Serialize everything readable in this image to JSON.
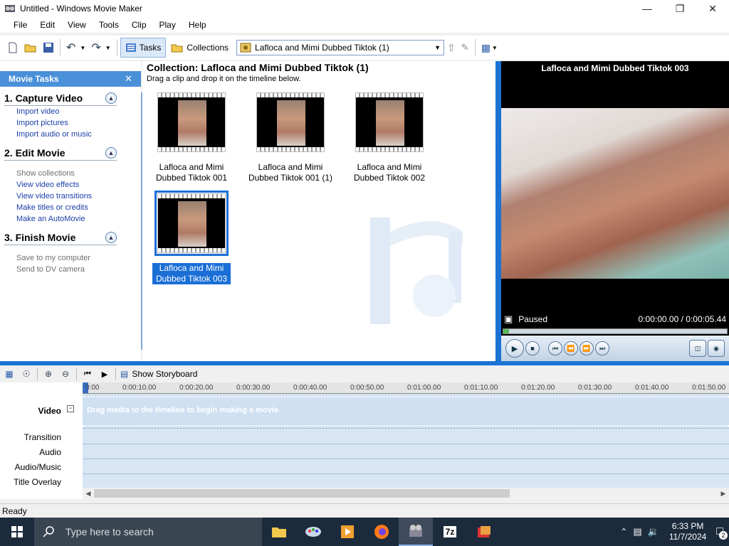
{
  "window": {
    "title": "Untitled - Windows Movie Maker"
  },
  "menu": [
    "File",
    "Edit",
    "View",
    "Tools",
    "Clip",
    "Play",
    "Help"
  ],
  "toolbar": {
    "tasks_label": "Tasks",
    "collections_label": "Collections",
    "collection_selected": "Lafloca and Mimi Dubbed Tiktok (1)"
  },
  "tasks": {
    "header": "Movie Tasks",
    "sections": [
      {
        "title": "1. Capture Video",
        "links": [
          {
            "label": "Import video",
            "enabled": true
          },
          {
            "label": "Import pictures",
            "enabled": true
          },
          {
            "label": "Import audio or music",
            "enabled": true
          }
        ]
      },
      {
        "title": "2. Edit Movie",
        "links": [
          {
            "label": "Show collections",
            "enabled": false
          },
          {
            "label": "View video effects",
            "enabled": true
          },
          {
            "label": "View video transitions",
            "enabled": true
          },
          {
            "label": "Make titles or credits",
            "enabled": true
          },
          {
            "label": "Make an AutoMovie",
            "enabled": true
          }
        ]
      },
      {
        "title": "3. Finish Movie",
        "links": [
          {
            "label": "Save to my computer",
            "enabled": false
          },
          {
            "label": "Send to DV camera",
            "enabled": false
          }
        ]
      }
    ]
  },
  "collection": {
    "title": "Collection: Lafloca and Mimi Dubbed Tiktok (1)",
    "subtitle": "Drag a clip and drop it on the timeline below.",
    "clips": [
      {
        "line1": "Lafloca and Mimi",
        "line2": "Dubbed Tiktok 001",
        "selected": false
      },
      {
        "line1": "Lafloca and Mimi",
        "line2": "Dubbed Tiktok 001 (1)",
        "selected": false
      },
      {
        "line1": "Lafloca and Mimi",
        "line2": "Dubbed Tiktok 002",
        "selected": false
      },
      {
        "line1": "Lafloca and Mimi",
        "line2": "Dubbed Tiktok 003",
        "selected": true
      }
    ]
  },
  "preview": {
    "title": "Lafloca and Mimi Dubbed Tiktok 003",
    "status": "Paused",
    "time": "0:00:00.00 / 0:00:05.44",
    "progress": 0.0
  },
  "timeline": {
    "storyboard_label": "Show Storyboard",
    "hint": "Drag media to the timeline to begin making a movie.",
    "ticks": [
      "0:00",
      "0:00:10.00",
      "0:00:20.00",
      "0:00:30.00",
      "0:00:40.00",
      "0:00:50.00",
      "0:01:00.00",
      "0:01:10.00",
      "0:01:20.00",
      "0:01:30.00",
      "0:01:40.00",
      "0:01:50.00"
    ],
    "tracks": {
      "video": "Video",
      "transition": "Transition",
      "audio": "Audio",
      "audio_music": "Audio/Music",
      "title_overlay": "Title Overlay"
    }
  },
  "status": {
    "text": "Ready"
  },
  "taskbar": {
    "search_placeholder": "Type here to search",
    "time": "6:33 PM",
    "date": "11/7/2024",
    "notification_count": "2"
  }
}
